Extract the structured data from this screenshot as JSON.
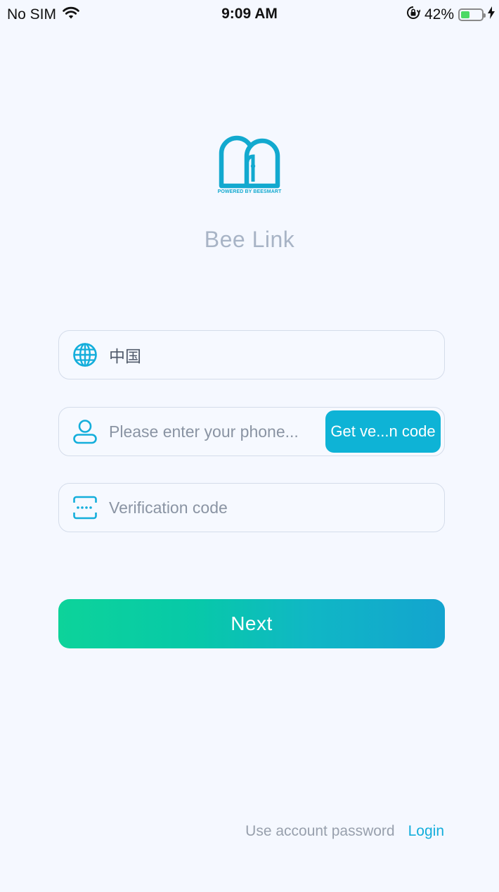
{
  "status_bar": {
    "carrier": "No SIM",
    "time": "9:09 AM",
    "battery_percent_text": "42%",
    "battery_level": 0.42,
    "wifi_icon": "wifi-icon",
    "orientation_lock_icon": "orientation-lock-icon",
    "charging_icon": "charging-bolt-icon"
  },
  "logo": {
    "caption": "POWERED BY BEESMART",
    "color": "#12a9cf"
  },
  "app": {
    "title": "Bee Link"
  },
  "form": {
    "region": {
      "icon": "globe-icon",
      "value": "中国"
    },
    "phone": {
      "icon": "user-icon",
      "placeholder": "Please enter your phone...",
      "get_code_label": "Get ve...n code"
    },
    "verification": {
      "icon": "verification-code-icon",
      "placeholder": "Verification code"
    },
    "next_label": "Next"
  },
  "footer": {
    "text": "Use account password",
    "login_label": "Login"
  },
  "colors": {
    "accent": "#14aedb",
    "button_gradient_start": "#0dd39a",
    "button_gradient_end": "#13a4cf",
    "background": "#f5f8ff"
  }
}
